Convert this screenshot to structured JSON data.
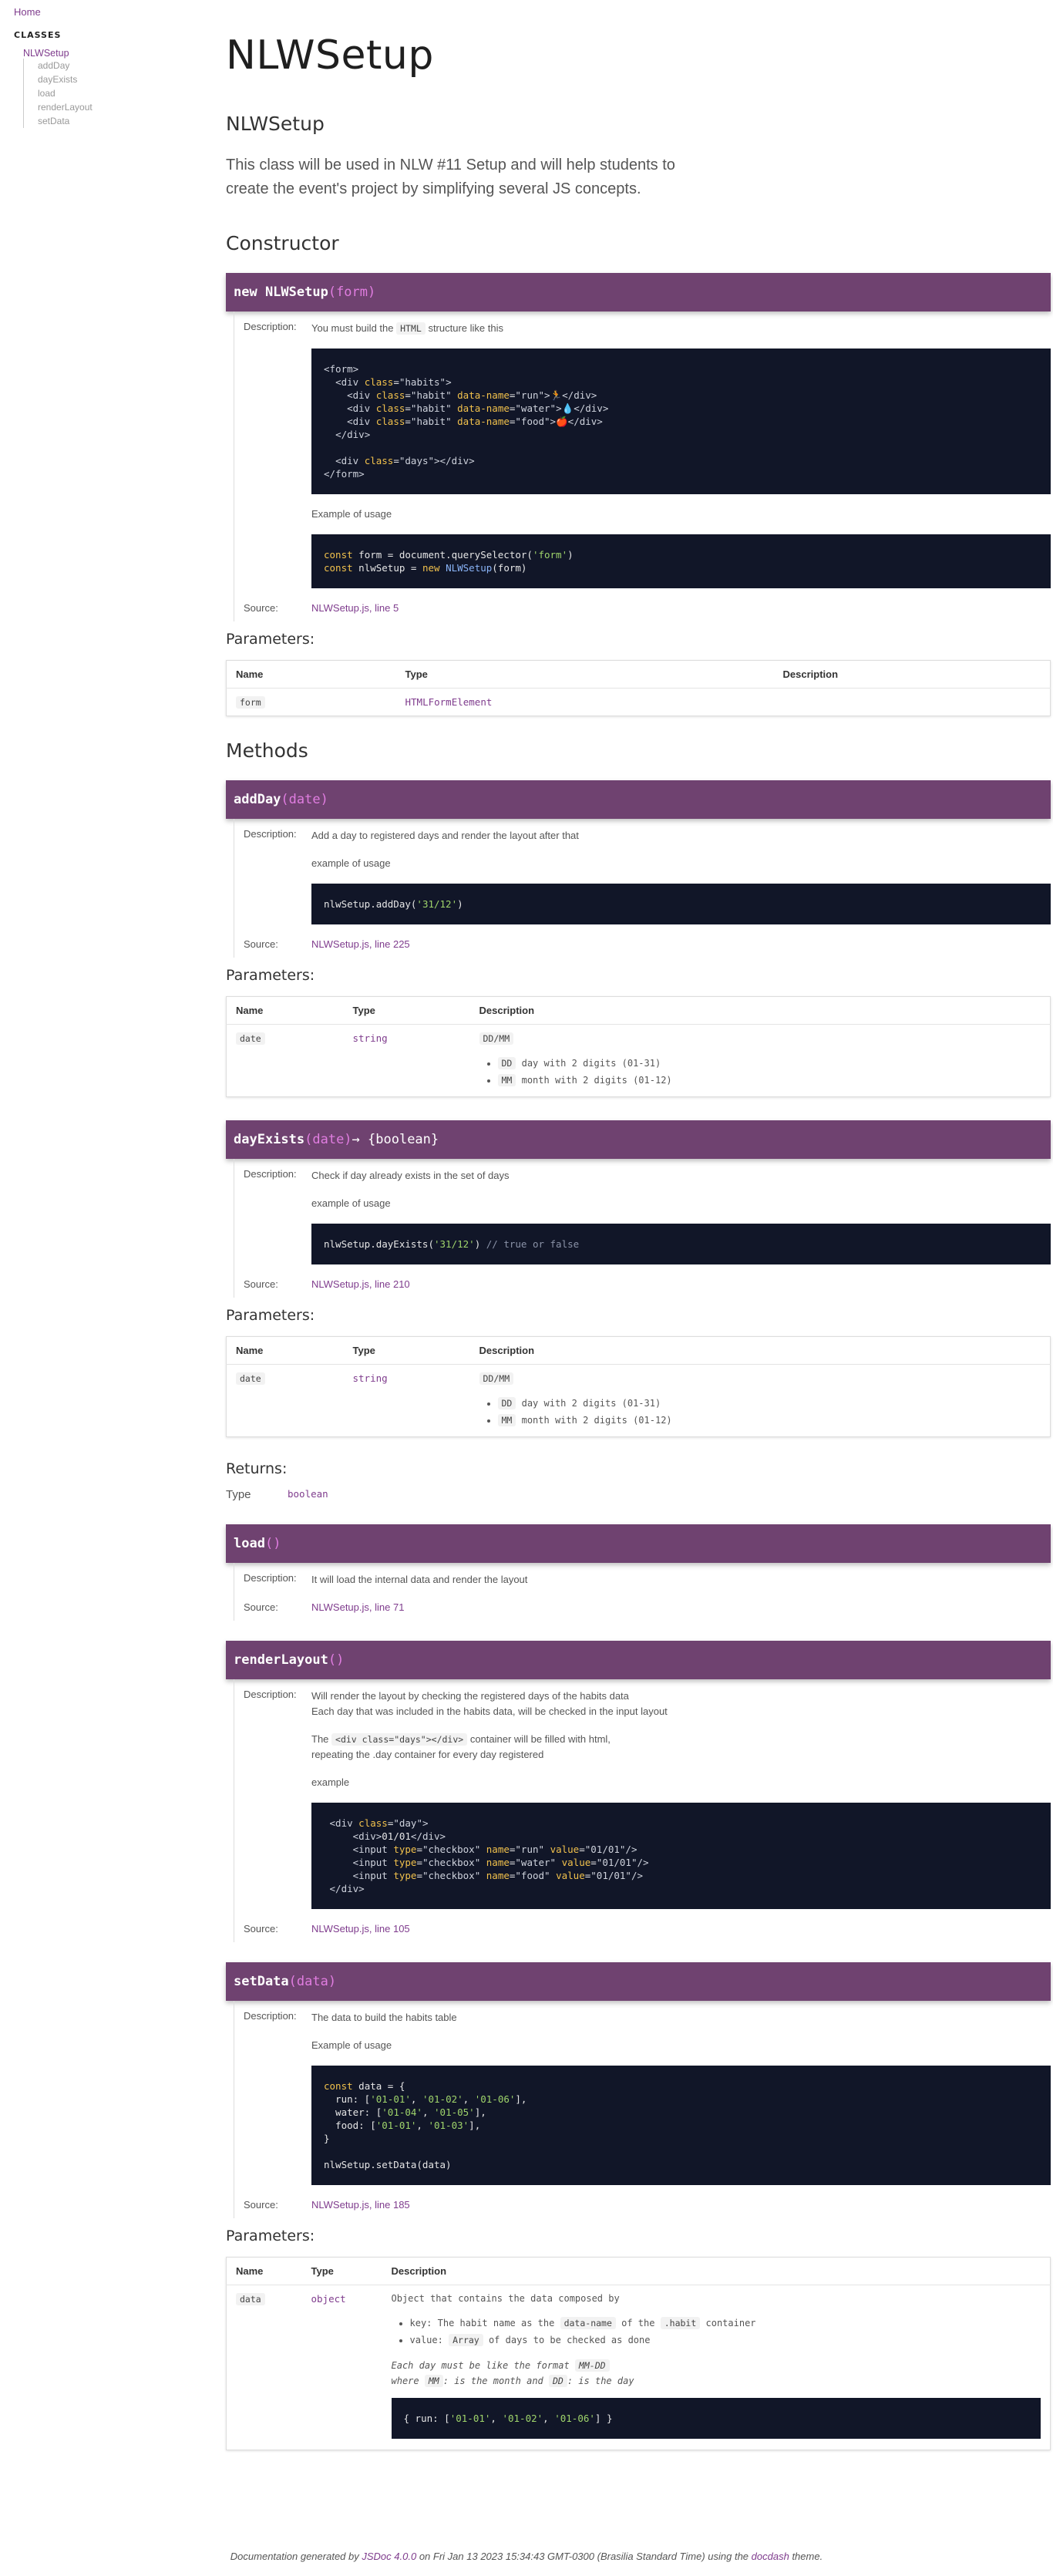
{
  "sidebar": {
    "home_label": "Home",
    "classes_heading": "CLASSES",
    "class_name": "NLWSetup",
    "methods": [
      "addDay",
      "dayExists",
      "load",
      "renderLayout",
      "setData"
    ]
  },
  "page": {
    "title": "NLWSetup",
    "class_name": "NLWSetup",
    "class_description": "This class will be used in NLW #11 Setup and will help students to create the event's project by simplifying several JS concepts."
  },
  "labels": {
    "constructor": "Constructor",
    "methods": "Methods",
    "parameters": "Parameters:",
    "description": "Description:",
    "source": "Source:",
    "returns": "Returns:",
    "type": "Type",
    "col_name": "Name",
    "col_type": "Type",
    "col_description": "Description"
  },
  "constructor": {
    "sig_name": "new NLWSetup",
    "sig_params": "(form)",
    "desc_prefix": "You must build the",
    "desc_code": "HTML",
    "desc_suffix": "structure like this",
    "example_label": "Example of usage",
    "source": "NLWSetup.js, line 5",
    "params": [
      {
        "name": "form",
        "type": "HTMLFormElement",
        "description": ""
      }
    ]
  },
  "addDay": {
    "sig_name": "addDay",
    "sig_params": "(date)",
    "description": "Add a day to registered days and render the layout after that",
    "example_label": "example of usage",
    "source": "NLWSetup.js, line 225",
    "param_name": "date",
    "param_type": "string",
    "param_format": "DD/MM",
    "bullets": [
      {
        "code": "DD",
        "text": "day with 2 digits (01-31)"
      },
      {
        "code": "MM",
        "text": "month with 2 digits (01-12)"
      }
    ]
  },
  "dayExists": {
    "sig_name": "dayExists",
    "sig_params": "(date)",
    "sig_ret": " → {boolean}",
    "description": "Check if day already exists in the set of days",
    "example_label": "example of usage",
    "source": "NLWSetup.js, line 210",
    "param_name": "date",
    "param_type": "string",
    "param_format": "DD/MM",
    "bullets": [
      {
        "code": "DD",
        "text": "day with 2 digits (01-31)"
      },
      {
        "code": "MM",
        "text": "month with 2 digits (01-12)"
      }
    ],
    "return_type": "boolean"
  },
  "load": {
    "sig_name": "load",
    "sig_params": "()",
    "description": "It will load the internal data and render the layout",
    "source": "NLWSetup.js, line 71"
  },
  "renderLayout": {
    "sig_name": "renderLayout",
    "sig_params": "()",
    "desc_line1": "Will render the layout by checking the registered days of the habits data",
    "desc_line2": "Each day that was included in the habits data, will be checked in the input layout",
    "desc_the": "The",
    "desc_code": "<div class=\"days\"></div>",
    "desc_after": "container will be filled with html,",
    "desc_line4": "repeating the .day container for every day registered",
    "example_label": "example",
    "source": "NLWSetup.js, line 105"
  },
  "setData": {
    "sig_name": "setData",
    "sig_params": "(data)",
    "description": "The data to build the habits table",
    "example_label": "Example of usage",
    "source": "NLWSetup.js, line 185",
    "param_name": "data",
    "param_type": "object",
    "param_desc": "Object that contains the data composed by",
    "b1_pre": "key: The habit name as the",
    "b1_code1": "data-name",
    "b1_mid": "of the",
    "b1_code2": ".habit",
    "b1_post": "container",
    "b2_pre": "value:",
    "b2_code": "Array",
    "b2_post": "of days to be checked as done",
    "note1_pre": "Each day must be like the format",
    "note1_code": "MM-DD",
    "note2_pre": "where",
    "note2_code1": "MM",
    "note2_mid": ": is the month and",
    "note2_code2": "DD",
    "note2_post": ": is the day"
  },
  "footer": {
    "prefix": "Documentation generated by",
    "jsdoc": "JSDoc 4.0.0",
    "middle": "on Fri Jan 13 2023 15:34:43 GMT-0300 (Brasilia Standard Time) using the",
    "theme": "docdash",
    "suffix": "theme."
  }
}
